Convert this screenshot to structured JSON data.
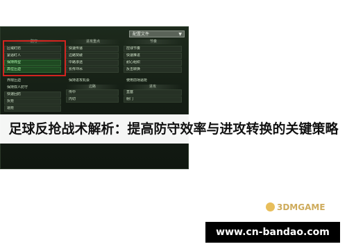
{
  "dropdown": {
    "value": "配置文件"
  },
  "columns": [
    {
      "header": "防守",
      "items": [
        {
          "label": "区域盯防"
        },
        {
          "label": "紧逼盯人"
        },
        {
          "label": "保持阵型"
        },
        {
          "label": "高位压迫"
        }
      ]
    },
    {
      "header": "进攻重点",
      "items": [
        {
          "label": "快速传递"
        },
        {
          "label": "边路突破"
        },
        {
          "label": "中路渗透"
        },
        {
          "label": "长传冲吊"
        }
      ]
    },
    {
      "header": "节奏",
      "items": [
        {
          "label": "控球节奏"
        },
        {
          "label": "快速推进"
        },
        {
          "label": "耐心组织"
        },
        {
          "label": "反击转换"
        }
      ]
    }
  ],
  "lower_left": [
    {
      "label": "界限压迫"
    },
    {
      "label": "保持双人防守"
    },
    {
      "label": "快速回防"
    },
    {
      "label": "反抢"
    },
    {
      "label": "逼抢"
    }
  ],
  "lower_mid": {
    "label": "保持进攻机会",
    "header": "边路",
    "items": [
      {
        "label": "传中"
      },
      {
        "label": "内切"
      }
    ]
  },
  "lower_right": {
    "label": "使用前场逼抢",
    "header": "进攻",
    "items": [
      {
        "label": "直塞"
      },
      {
        "label": "射门"
      }
    ]
  },
  "overlay_title": "足球反抢战术解析：提高防守效率与进攻转换的关键策略",
  "watermark": "3DMGAME",
  "url": "www.cn-bandao.com"
}
